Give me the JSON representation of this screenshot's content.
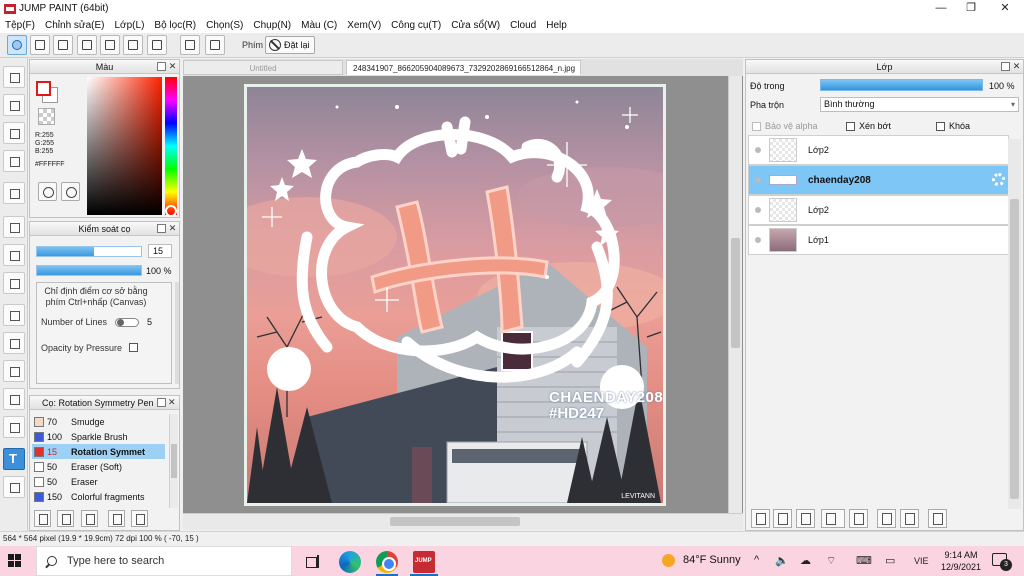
{
  "window": {
    "title": "JUMP PAINT (64bit)",
    "minimize_glyph": "—",
    "restore_glyph": "❐",
    "close_glyph": "✕"
  },
  "menu": [
    "Tệp(F)",
    "Chỉnh sửa(E)",
    "Lớp(L)",
    "Bộ lọc(R)",
    "Chọn(S)",
    "Chụp(N)",
    "Màu (C)",
    "Xem(V)",
    "Công cụ(T)",
    "Cửa sổ(W)",
    "Cloud",
    "Help"
  ],
  "toolbar": {
    "phim_label": "Phím",
    "reset_label": "Đặt lại"
  },
  "color_panel": {
    "title": "Màu",
    "r": "R:255",
    "g": "G:255",
    "b": "B:255",
    "hex": "#FFFFFF",
    "foreground": "#FFFFFF",
    "foreground_border": "#E01818"
  },
  "brush_panel": {
    "title": "Kiểm soát cọ",
    "size": "15",
    "opacity": "100 %",
    "size_fill": 0.55,
    "opacity_fill": 1.0,
    "hint": "Chỉ định điểm cơ sở bằng phím Ctrl+nhấp (Canvas)",
    "lines_label": "Number of Lines",
    "lines_value": "5",
    "pressure_label": "Opacity by Pressure"
  },
  "brush_list": {
    "title": "Cọ: Rotation Symmetry Pen",
    "items": [
      {
        "size": "70",
        "name": "Smudge",
        "color": "#F5D9C8"
      },
      {
        "size": "100",
        "name": "Sparkle Brush",
        "color": "#3B5BDB"
      },
      {
        "size": "15",
        "name": "Rotation Symmet",
        "color": "#E03131"
      },
      {
        "size": "50",
        "name": "Eraser (Soft)",
        "color": "#FFFFFF"
      },
      {
        "size": "50",
        "name": "Eraser",
        "color": "#FFFFFF"
      },
      {
        "size": "150",
        "name": "Colorful fragments",
        "color": "#3B5BDB"
      }
    ]
  },
  "tabs": [
    {
      "label": "Untitled"
    },
    {
      "label": "248341907_866205904089673_7329202869166512864_n.jpg"
    }
  ],
  "artwork": {
    "handle": "CHAENDAY208",
    "tag": "#HD247",
    "signature": "LEVITANN"
  },
  "layer_panel": {
    "title": "Lớp",
    "opacity_label": "Độ trong",
    "opacity_value": "100 %",
    "blend_label": "Pha trộn",
    "blend_value": "Bình thường",
    "protect_alpha": "Bảo vệ alpha",
    "clip": "Xén bớt",
    "lock": "Khóa",
    "layers": [
      {
        "name": "Lớp2",
        "thumb": "blank"
      },
      {
        "name": "chaenday208",
        "thumb": "text",
        "selected": true
      },
      {
        "name": "Lớp2",
        "thumb": "blank"
      },
      {
        "name": "Lớp1",
        "thumb": "photo"
      }
    ]
  },
  "status": {
    "text": "564 * 564 pixel  (19.9 * 19.9cm)  72 dpi  100 %  ( -70, 15 )"
  },
  "taskbar": {
    "search_placeholder": "Type here to search",
    "weather": "84°F  Sunny",
    "lang": "VIE",
    "time": "9:14 AM",
    "date": "12/9/2021",
    "notifications": "3"
  }
}
